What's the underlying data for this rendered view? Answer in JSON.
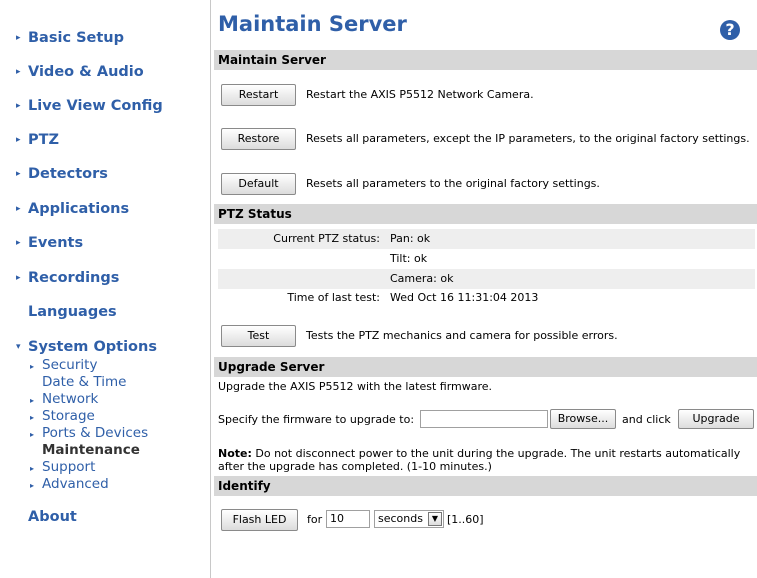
{
  "sidebar": {
    "items": [
      {
        "label": "Basic Setup"
      },
      {
        "label": "Video & Audio"
      },
      {
        "label": "Live View Config"
      },
      {
        "label": "PTZ"
      },
      {
        "label": "Detectors"
      },
      {
        "label": "Applications"
      },
      {
        "label": "Events"
      },
      {
        "label": "Recordings"
      },
      {
        "label": "Languages"
      },
      {
        "label": "System Options"
      },
      {
        "label": "About"
      }
    ],
    "sub_items": [
      {
        "label": "Security"
      },
      {
        "label": "Date & Time"
      },
      {
        "label": "Network"
      },
      {
        "label": "Storage"
      },
      {
        "label": "Ports & Devices"
      },
      {
        "label": "Maintenance"
      },
      {
        "label": "Support"
      },
      {
        "label": "Advanced"
      }
    ]
  },
  "page": {
    "title": "Maintain Server",
    "help_glyph": "?"
  },
  "maintain": {
    "header": "Maintain Server",
    "restart_label": "Restart",
    "restart_desc": "Restart the AXIS P5512 Network Camera.",
    "restore_label": "Restore",
    "restore_desc": "Resets all parameters, except the IP parameters, to the original factory settings.",
    "default_label": "Default",
    "default_desc": "Resets all parameters to the original factory settings."
  },
  "ptz_status": {
    "header": "PTZ Status",
    "current_label": "Current PTZ status:",
    "pan": "Pan: ok",
    "tilt": "Tilt: ok",
    "camera": "Camera: ok",
    "time_label": "Time of last test:",
    "time_value": "Wed Oct 16 11:31:04 2013",
    "test_label": "Test",
    "test_desc": "Tests the PTZ mechanics and camera for possible errors."
  },
  "upgrade": {
    "header": "Upgrade Server",
    "intro": "Upgrade the AXIS P5512 with the latest firmware.",
    "specify_label": "Specify the firmware to upgrade to:",
    "file_value": "",
    "browse_label": "Browse...",
    "and_click": "and click",
    "upgrade_label": "Upgrade",
    "note_bold": "Note:",
    "note_text": " Do not disconnect power to the unit during the upgrade. The unit restarts automatically after the upgrade has completed. (1-10 minutes.)"
  },
  "identify": {
    "header": "Identify",
    "flash_label": "Flash LED",
    "for_label": "for",
    "duration_value": "10",
    "unit_selected": "seconds",
    "range": "[1..60]"
  },
  "icons": {
    "collapsed": "▸",
    "expanded": "▾",
    "dropdown": "▼"
  },
  "colors": {
    "accent": "#2f5fa8",
    "section_bar": "#d7d7d7",
    "alt_row": "#eeeeee"
  }
}
